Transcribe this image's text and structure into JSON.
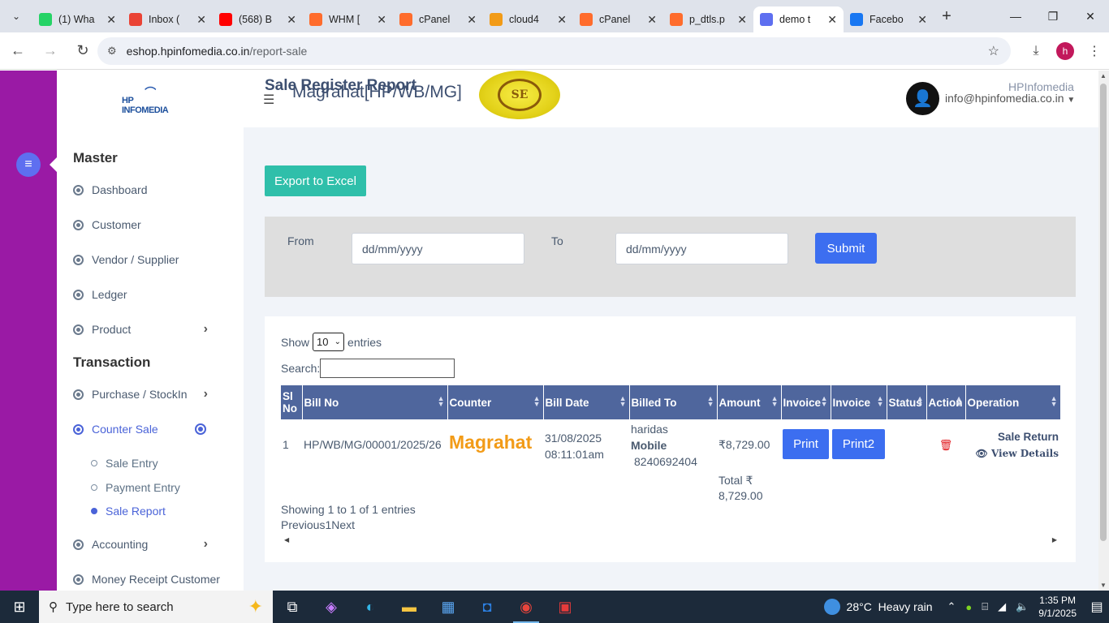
{
  "browser": {
    "tabs": [
      {
        "title": "(1) Wha",
        "icon": "whatsapp-icon",
        "color": "#25d366"
      },
      {
        "title": "Inbox (",
        "icon": "gmail-icon",
        "color": "#ea4335"
      },
      {
        "title": "(568) B",
        "icon": "youtube-icon",
        "color": "#ff0000"
      },
      {
        "title": "WHM [",
        "icon": "cpanel-icon",
        "color": "#ff6c2c"
      },
      {
        "title": "cPanel",
        "icon": "cpanel-icon",
        "color": "#ff6c2c"
      },
      {
        "title": "cloud4",
        "icon": "phpmyadmin-icon",
        "color": "#f29b17"
      },
      {
        "title": "cPanel",
        "icon": "cpanel-icon",
        "color": "#ff6c2c"
      },
      {
        "title": "p_dtls.p",
        "icon": "cpanel-icon",
        "color": "#ff6c2c"
      },
      {
        "title": "demo t",
        "icon": "site-icon",
        "color": "#5e6ff0",
        "active": true
      },
      {
        "title": "Facebo",
        "icon": "facebook-icon",
        "color": "#1877f2"
      }
    ],
    "url_host": "eshop.hpinfomedia.co.in",
    "url_path": "/report-sale",
    "profile_initial": "h"
  },
  "header": {
    "brand_title": "Magrahat[HP/WB/MG]",
    "seal_text": "SE",
    "user_email": "info@hpinfomedia.co.in",
    "logo_text": "HP INFOMEDIA"
  },
  "sidebar": {
    "master_title": "Master",
    "master_items": [
      "Dashboard",
      "Customer",
      "Vendor / Supplier",
      "Ledger",
      "Product"
    ],
    "transaction_title": "Transaction",
    "transaction_items": [
      "Purchase / StockIn",
      "Counter Sale"
    ],
    "counter_sale_sub": [
      "Sale Entry",
      "Payment Entry",
      "Sale Report"
    ],
    "more_items": [
      "Accounting",
      "Money Receipt Customer"
    ]
  },
  "page": {
    "title": "Sale Register Report",
    "breadcrumb": "HPInfomedia",
    "export_label": "Export to Excel",
    "from_label": "From",
    "to_label": "To",
    "date_placeholder": "dd/mm/yyyy",
    "submit_label": "Submit"
  },
  "table": {
    "show_label": "Show",
    "entries_label": "entries",
    "page_size": "10",
    "search_label": "Search:",
    "headers": [
      "Sl No",
      "Bill No",
      "Counter",
      "Bill Date",
      "Billed To",
      "Amount",
      "Invoice",
      "Invoice",
      "Status",
      "Action",
      "Operation"
    ],
    "row": {
      "sl": "1",
      "bill_no": "HP/WB/MG/00001/2025/26",
      "counter": "Magrahat",
      "bill_date": "31/08/2025",
      "bill_time": "08:11:01am",
      "billed_name": "haridas",
      "mobile_label": "Mobile",
      "mobile": "8240692404",
      "amount": "₹8,729.00",
      "print_label": "Print",
      "print2_label": "Print2",
      "sale_return": "Sale Return",
      "view_details": "View Details"
    },
    "total_label": "Total ₹",
    "total_value": "8,729.00",
    "showing": "Showing 1 to 1 of 1 entries",
    "pager": "Previous1Next"
  },
  "taskbar": {
    "search_placeholder": "Type here to search",
    "temperature": "28°C",
    "weather": "Heavy rain",
    "time": "1:35 PM",
    "date": "9/1/2025"
  }
}
